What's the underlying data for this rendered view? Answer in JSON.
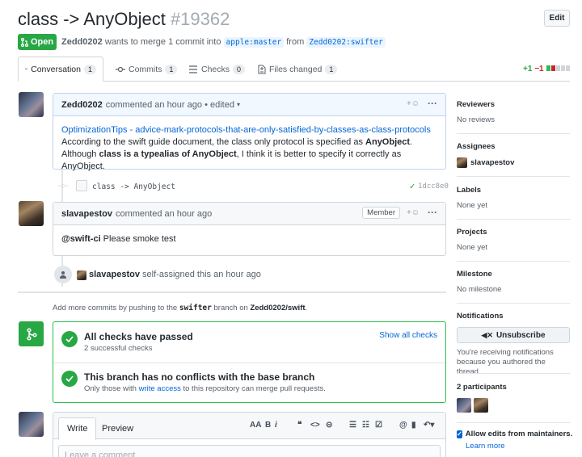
{
  "pr": {
    "title": "class -> AnyObject",
    "number": "#19362",
    "edit_label": "Edit",
    "state": "Open",
    "author": "Zedd0202",
    "summary_mid": "wants to merge 1 commit into",
    "base_branch": "apple:master",
    "summary_from": "from",
    "head_branch": "Zedd0202:swifter"
  },
  "tabs": [
    {
      "label": "Conversation",
      "count": "1"
    },
    {
      "label": "Commits",
      "count": "1"
    },
    {
      "label": "Checks",
      "count": "0"
    },
    {
      "label": "Files changed",
      "count": "1"
    }
  ],
  "diffstat": {
    "added": "+1",
    "removed": "−1"
  },
  "comment1": {
    "author": "Zedd0202",
    "meta": "commented an hour ago",
    "edited": "• edited",
    "link": "OptimizationTips - advice-mark-protocols-that-are-only-satisfied-by-classes-as-class-protocols",
    "line2_pre": "According to the swift guide document, the class only protocol is specified as ",
    "line2_bold": "AnyObject",
    "line2_post": ".",
    "line3_pre": "Although ",
    "line3_bold": "class is a typealias of AnyObject",
    "line3_post": ", I think it is better to specify it correctly as AnyObject."
  },
  "commit": {
    "message": "class -> AnyObject",
    "sha": "1dcc8e0"
  },
  "comment2": {
    "author": "slavapestov",
    "meta": "commented an hour ago",
    "badge": "Member",
    "mention": "@swift-ci",
    "text": " Please smoke test"
  },
  "event": {
    "actor": "slavapestov",
    "text": "self-assigned this an hour ago"
  },
  "push_hint": {
    "pre": "Add more commits by pushing to the ",
    "branch": "swifter",
    "mid": " branch on ",
    "repo": "Zedd0202/swift",
    "post": "."
  },
  "checks": {
    "title": "All checks have passed",
    "subtitle": "2 successful checks",
    "link": "Show all checks",
    "conflict_title": "This branch has no conflicts with the base branch",
    "conflict_pre": "Only those with ",
    "conflict_link": "write access",
    "conflict_post": " to this repository can merge pull requests."
  },
  "composer": {
    "tab_write": "Write",
    "tab_preview": "Preview",
    "placeholder": "Leave a comment"
  },
  "sidebar": {
    "reviewers_h": "Reviewers",
    "reviewers_v": "No reviews",
    "assignees_h": "Assignees",
    "assignee": "slavapestov",
    "labels_h": "Labels",
    "labels_v": "None yet",
    "projects_h": "Projects",
    "projects_v": "None yet",
    "milestone_h": "Milestone",
    "milestone_v": "No milestone",
    "notifications_h": "Notifications",
    "unsubscribe": "Unsubscribe",
    "notif_text1": "You're receiving notifications",
    "notif_text2": "because you authored the thread.",
    "participants_h": "2 participants",
    "allow_edits": "Allow edits from maintainers.",
    "learn_more": "Learn more"
  },
  "colors": {
    "green": "#28a745",
    "red": "#cb2431",
    "link": "#0366d6"
  }
}
